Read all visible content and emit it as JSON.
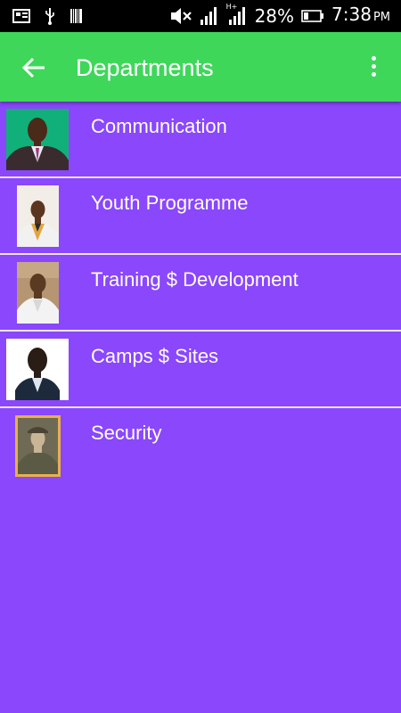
{
  "status_bar": {
    "battery_percent": "28%",
    "time": "7:38",
    "ampm": "PM",
    "network_type": "H+"
  },
  "app_bar": {
    "title": "Departments",
    "background_color": "#3ed75a"
  },
  "colors": {
    "list_background": "#8a47fc",
    "divider": "#ece4f8"
  },
  "departments": [
    {
      "label": "Communication"
    },
    {
      "label": "Youth Programme"
    },
    {
      "label": "Training $ Development"
    },
    {
      "label": "Camps $ Sites"
    },
    {
      "label": "Security"
    }
  ]
}
